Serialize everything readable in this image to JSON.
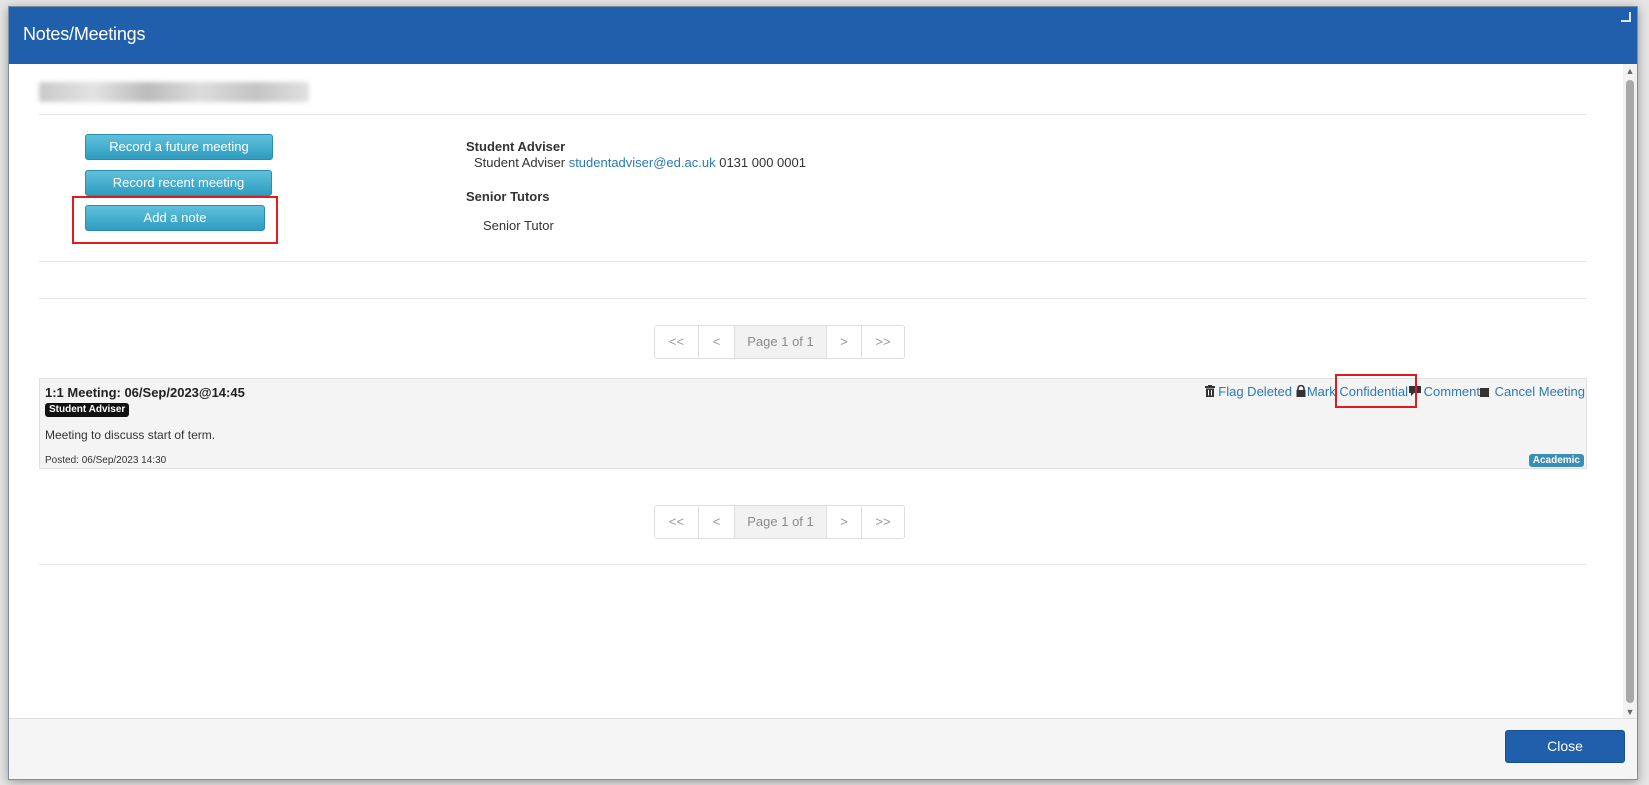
{
  "modal": {
    "title": "Notes/Meetings",
    "close_label": "Close"
  },
  "actions_panel": {
    "record_future_label": "Record a future meeting",
    "record_recent_label": "Record recent meeting",
    "add_note_label": "Add a note"
  },
  "contacts": {
    "adviser_heading": "Student Adviser",
    "adviser_role": "Student Adviser",
    "adviser_email": "studentadviser@ed.ac.uk",
    "adviser_phone": "0131 000 0001",
    "tutors_heading": "Senior Tutors",
    "tutor_role": "Senior Tutor"
  },
  "pager": {
    "first": "<<",
    "prev": "<",
    "page_label": "Page 1 of 1",
    "next": ">",
    "last": ">>"
  },
  "meeting": {
    "title": "1:1 Meeting: 06/Sep/2023@14:45",
    "role_badge": "Student Adviser",
    "text": "Meeting to discuss start of term.",
    "posted": "Posted: 06/Sep/2023 14:30",
    "category_badge": "Academic",
    "actions": {
      "flag_deleted": "Flag Deleted",
      "mark_confidential": "Mark Confidential",
      "comment": "Comment",
      "cancel_meeting": "Cancel Meeting"
    }
  },
  "icons": {
    "delete": "trash-icon",
    "confidential": "lock-icon",
    "comment": "speech-bubble-icon",
    "cancel": "square-icon"
  },
  "colors": {
    "header": "#1f5fac",
    "teal_button": "#3aa9cc",
    "link": "#2a7ab8",
    "highlight": "#e01b1b",
    "academic_badge": "#3a8fb7"
  }
}
